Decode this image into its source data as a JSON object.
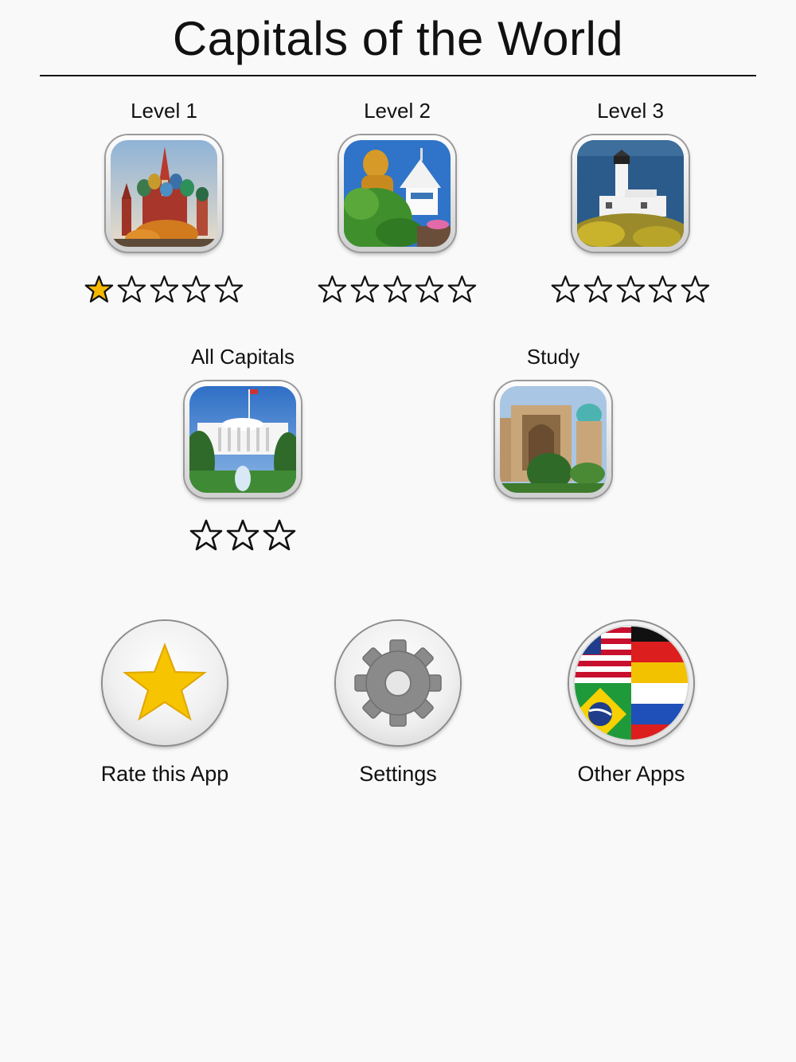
{
  "header": {
    "title": "Capitals of the World"
  },
  "levels": [
    {
      "label": "Level 1",
      "stars_total": 5,
      "stars_filled": 1,
      "image": "st-basils-cathedral"
    },
    {
      "label": "Level 2",
      "stars_total": 5,
      "stars_filled": 0,
      "image": "golden-buddha-temple"
    },
    {
      "label": "Level 3",
      "stars_total": 5,
      "stars_filled": 0,
      "image": "lighthouse-coast"
    }
  ],
  "modes": [
    {
      "label": "All Capitals",
      "stars_total": 3,
      "stars_filled": 0,
      "image": "white-house"
    },
    {
      "label": "Study",
      "image": "madrasa"
    }
  ],
  "actions": [
    {
      "label": "Rate this App",
      "icon": "star-icon"
    },
    {
      "label": "Settings",
      "icon": "gear-icon"
    },
    {
      "label": "Other Apps",
      "icon": "flags-icon"
    }
  ],
  "colors": {
    "star_filled": "#f6b800",
    "star_outline": "#111111",
    "background": "#f9f9f9"
  }
}
